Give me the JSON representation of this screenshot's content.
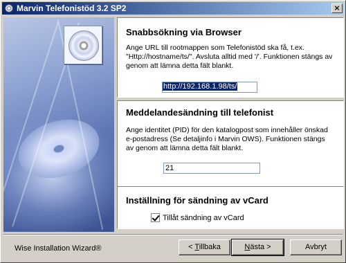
{
  "window": {
    "title": "Marvin Telefonistöd 3.2 SP2",
    "close_label": "×"
  },
  "section1": {
    "heading": "Snabbsökning via Browser",
    "description": "Ange URL till rootmappen som Telefonistöd ska få, t.ex. \"Http://hostname/ts/\". Avsluta alltid med '/'. Funktionen stängs av genom att lämna detta fält blankt.",
    "url_value": "http://192.168.1.98/ts/"
  },
  "section2": {
    "heading": "Meddelandesändning till telefonist",
    "description": "Ange identitet (PID) för den katalogpost som innehåller önskad e-postadress (Se detaljinfo i Marvin OWS). Funktionen stängs av genom att lämna detta fält blankt.",
    "pid_value": "21"
  },
  "section3": {
    "heading": "Inställning för sändning av vCard",
    "checkbox_label": "Tillåt sändning av vCard",
    "checkbox_checked": true
  },
  "footer": {
    "brand": "Wise Installation Wizard®",
    "back": {
      "prefix": "< ",
      "accel": "T",
      "rest": "illbaka"
    },
    "next": {
      "accel": "N",
      "rest": "ästa >"
    },
    "cancel": "Avbryt"
  }
}
